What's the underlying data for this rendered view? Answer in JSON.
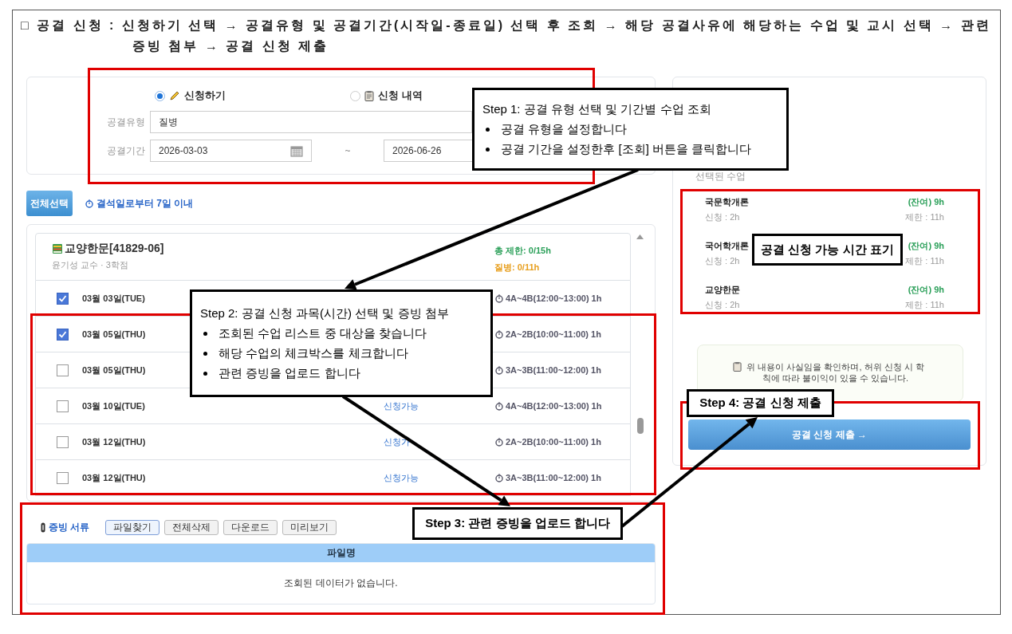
{
  "header": {
    "text": "□ 공결 신청 : 신청하기 선택 → 공결유형 및 공결기간(시작일-종료일) 선택 후 조회 → 해당 공결사유에 해당하는 수업 및 교시 선택 → 관련 증빙 첨부 → 공결 신청 제출"
  },
  "form": {
    "modes": [
      {
        "kind": "apply",
        "label": "신청하기",
        "selected": true
      },
      {
        "kind": "history",
        "label": "신청 내역",
        "selected": false
      }
    ],
    "type_field": {
      "label": "공결유형",
      "value": "질병"
    },
    "period": {
      "label": "공결기간",
      "start": "2026-03-03",
      "separator": "~",
      "end": "2026-06-26"
    }
  },
  "toolbar": {
    "select_all": "전체선택",
    "notice": "결석일로부터 7일 이내"
  },
  "course": {
    "title": "교양한문[41829-06]",
    "subtitle": "윤기성 교수 · 3학점",
    "total": "총 제한: 0/15h",
    "sick": "질병: 0/11h"
  },
  "sessions": [
    {
      "date": "03월 03일(TUE)",
      "checked": true,
      "time": "4A~4B(12:00~13:00) 1h"
    },
    {
      "date": "03월 05일(THU)",
      "checked": true,
      "time": "2A~2B(10:00~11:00) 1h"
    },
    {
      "date": "03월 05일(THU)",
      "checked": false,
      "time": "3A~3B(11:00~12:00) 1h"
    },
    {
      "date": "03월 10일(TUE)",
      "checked": false,
      "status": "신청가능",
      "time": "4A~4B(12:00~13:00) 1h"
    },
    {
      "date": "03월 12일(THU)",
      "checked": false,
      "status": "신청가",
      "time": "2A~2B(10:00~11:00) 1h"
    },
    {
      "date": "03월 12일(THU)",
      "checked": false,
      "status": "신청가능",
      "time": "3A~3B(11:00~12:00) 1h"
    }
  ],
  "evidence": {
    "title": "증빙 서류",
    "buttons": [
      {
        "kind": "primary",
        "label": "파일찾기"
      },
      {
        "kind": "default",
        "label": "전체삭제"
      },
      {
        "kind": "default",
        "label": "다운로드"
      },
      {
        "kind": "default",
        "label": "미리보기"
      }
    ],
    "table": {
      "columns": [
        "파일명"
      ],
      "empty": "조회된 데이터가 없습니다."
    }
  },
  "summary": {
    "title": "선택된 수업",
    "items": [
      {
        "name": "국문학개론",
        "applied": "신청 : 2h",
        "remaining": "(잔여) 9h",
        "limit": "제한 : 11h"
      },
      {
        "name": "국어학개론",
        "applied": "신청 : 2h",
        "remaining": "(잔여) 9h",
        "limit": "제한 : 11h"
      },
      {
        "name": "교양한문",
        "applied": "신청 : 2h",
        "remaining": "(잔여) 9h",
        "limit": "제한 : 11h"
      }
    ],
    "notice": "위 내용이 사실임을 확인하며, 허위 신청 시 학칙에 따라 불이익이 있을 수 있습니다.",
    "submit": "공결 신청 제출 →"
  },
  "callouts": [
    {
      "title": "Step 1: 공결 유형 선택 및 기간별 수업 조회",
      "bullets": [
        "공결 유형을 설정합니다",
        "공결 기간을 설정한후 [조회] 버튼을 클릭합니다"
      ]
    },
    {
      "title": "Step 2: 공결 신청 과목(시간) 선택 및 증빙 첨부",
      "bullets": [
        "조회된 수업 리스트 중 대상을 찾습니다",
        "해당 수업의 체크박스를 체크합니다",
        "관련 증빙을 업로드 합니다"
      ]
    },
    {
      "title": "Step 3: 관련 증빙을 업로드 합니다"
    },
    {
      "title": "Step 4: 공결 신청 제출"
    },
    {
      "title": "공결 신청 가능 시간 표기"
    }
  ]
}
